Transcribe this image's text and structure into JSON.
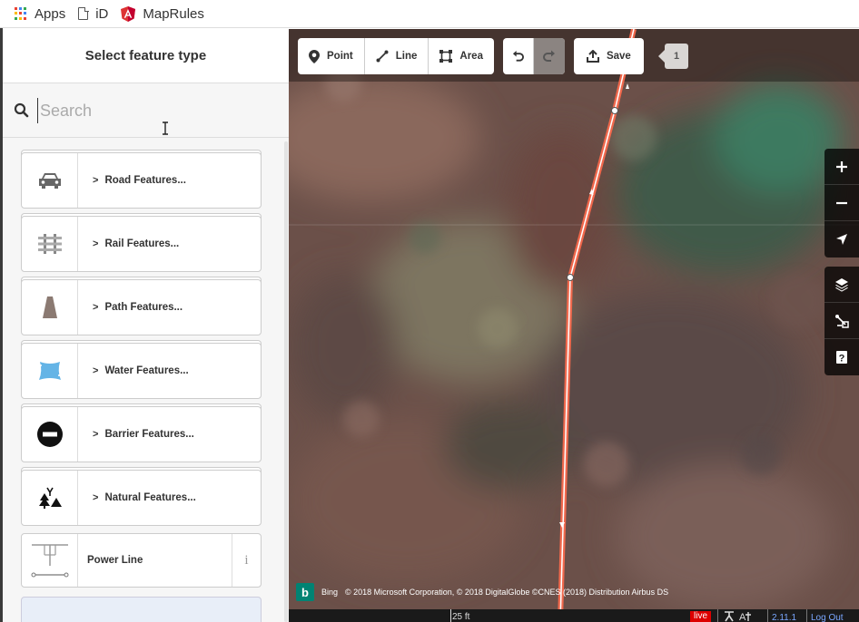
{
  "bookmarks": {
    "items": [
      {
        "label": "Apps",
        "icon": "apps-grid-icon"
      },
      {
        "label": "iD",
        "icon": "page-icon"
      },
      {
        "label": "MapRules",
        "icon": "angular-icon"
      }
    ]
  },
  "sidebar": {
    "title": "Select feature type",
    "search": {
      "placeholder": "Search",
      "value": ""
    },
    "presets": [
      {
        "label": "Road Features...",
        "icon": "car-icon",
        "category": true
      },
      {
        "label": "Rail Features...",
        "icon": "rail-icon",
        "category": true
      },
      {
        "label": "Path Features...",
        "icon": "path-icon",
        "category": true
      },
      {
        "label": "Water Features...",
        "icon": "water-icon",
        "category": true
      },
      {
        "label": "Barrier Features...",
        "icon": "barrier-icon",
        "category": true
      },
      {
        "label": "Natural Features...",
        "icon": "natural-icon",
        "category": true
      },
      {
        "label": "Power Line",
        "icon": "power-line-icon",
        "category": false,
        "info": "i"
      }
    ]
  },
  "toolbar": {
    "point_label": "Point",
    "line_label": "Line",
    "area_label": "Area",
    "save_label": "Save",
    "edit_count": "1"
  },
  "map_controls": [
    "zoom-in",
    "zoom-out",
    "geolocate",
    "background",
    "map-data",
    "help"
  ],
  "attribution": {
    "provider": "Bing",
    "text": "© 2018 Microsoft Corporation, © 2018 DigitalGlobe ©CNES (2018) Distribution Airbus DS"
  },
  "footer": {
    "scale": "25 ft",
    "live": "live",
    "version": "2.11.1",
    "logout": "Log Out"
  },
  "colors": {
    "accent_line": "#ff6a4d",
    "toolbar_bg": "#ffffff",
    "water_blue": "#64b4e6",
    "bing": "#008373"
  }
}
